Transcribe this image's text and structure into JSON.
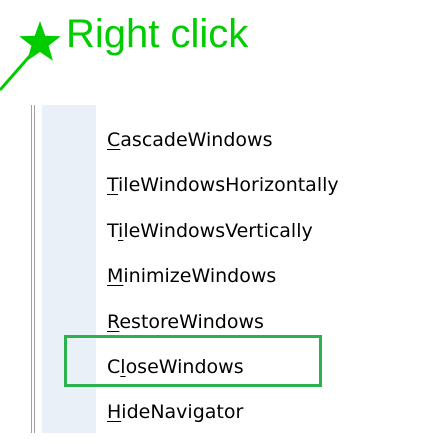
{
  "annotation": {
    "text": "Right click",
    "star_icon": "star-icon",
    "pointer_icon": "pointer-line",
    "color": "#00cc00"
  },
  "context_menu": {
    "items": [
      {
        "mnemonic": "C",
        "rest": "ascadeWindows",
        "name": "menu-item-cascade-windows"
      },
      {
        "mnemonic": "T",
        "rest": "ileWindowsHorizontally",
        "name": "menu-item-tile-windows-horizontally"
      },
      {
        "prefix": "T",
        "mnemonic": "i",
        "rest": "leWindowsVertically",
        "name": "menu-item-tile-windows-vertically"
      },
      {
        "mnemonic": "M",
        "rest": "inimizeWindows",
        "name": "menu-item-minimize-windows"
      },
      {
        "mnemonic": "R",
        "rest": "estoreWindows",
        "name": "menu-item-restore-windows"
      },
      {
        "prefix": "C",
        "mnemonic": "l",
        "rest": "oseWindows",
        "name": "menu-item-close-windows"
      },
      {
        "mnemonic": "H",
        "rest": "ideNavigator",
        "name": "menu-item-hide-navigator"
      }
    ],
    "highlighted_item": "CloseWindows",
    "highlight_color": "#2bb24c",
    "gutter_color": "#e9f0f8"
  }
}
